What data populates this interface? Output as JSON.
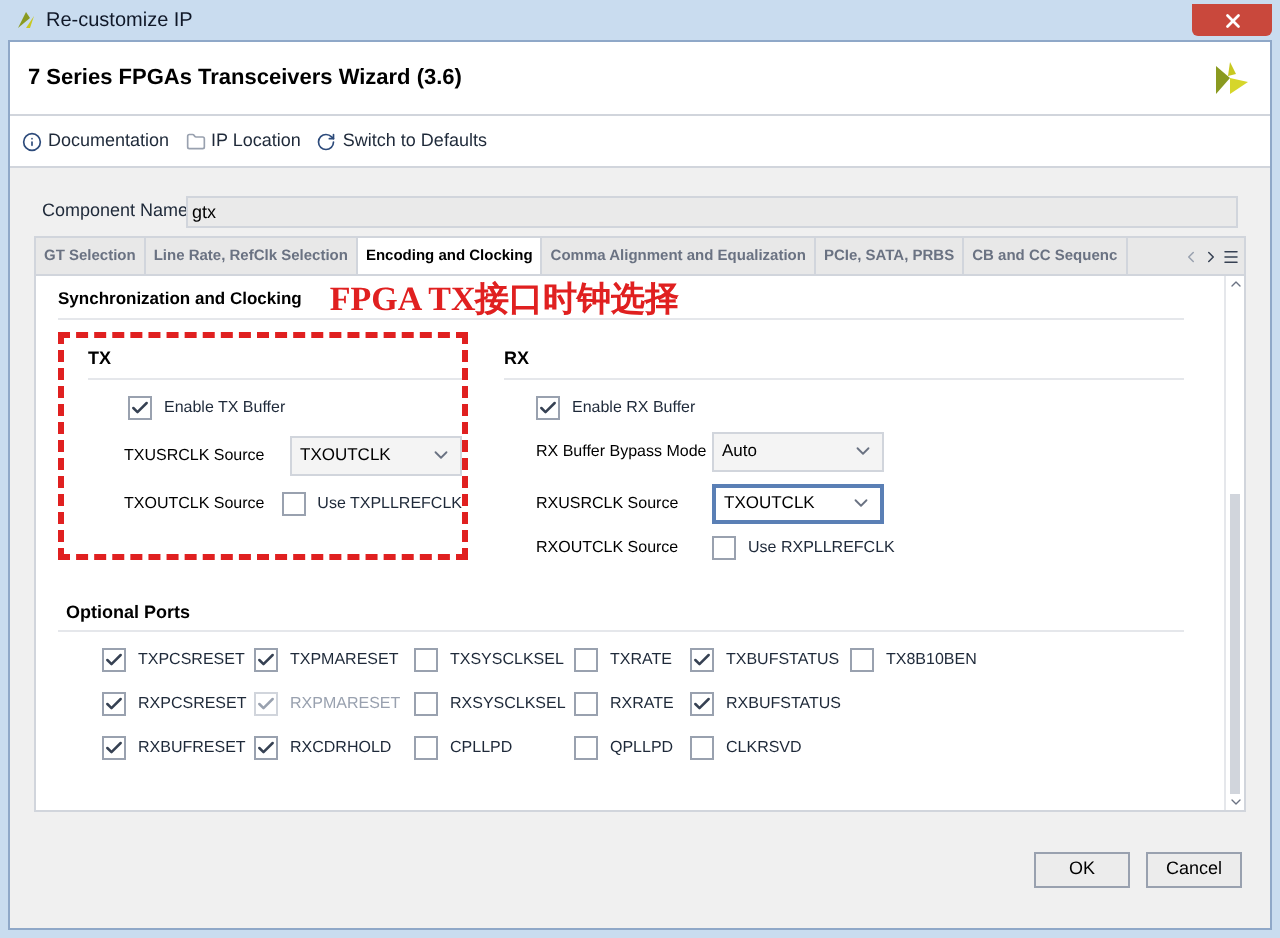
{
  "window": {
    "title": "Re-customize IP"
  },
  "header": {
    "title": "7 Series FPGAs Transceivers Wizard (3.6)"
  },
  "toolbar": [
    {
      "kind": "info",
      "label": "Documentation"
    },
    {
      "kind": "folder",
      "label": "IP Location"
    },
    {
      "kind": "reset",
      "label": "Switch to Defaults"
    }
  ],
  "component_name": {
    "label": "Component Name",
    "value": "gtx"
  },
  "tabs": [
    {
      "label": "GT Selection",
      "selected": false
    },
    {
      "label": "Line Rate, RefClk Selection",
      "selected": false
    },
    {
      "label": "Encoding and Clocking",
      "selected": true
    },
    {
      "label": "Comma Alignment and Equalization",
      "selected": false
    },
    {
      "label": "PCIe, SATA, PRBS",
      "selected": false
    },
    {
      "label": "CB and CC Sequenc",
      "selected": false
    }
  ],
  "section_title": "Synchronization and Clocking",
  "annotation": "FPGA TX接口时钟选择",
  "tx": {
    "title": "TX",
    "buffer": {
      "label": "Enable TX Buffer",
      "checked": true
    },
    "usrclk_label": "TXUSRCLK Source",
    "usrclk_value": "TXOUTCLK",
    "outclk_label": "TXOUTCLK Source",
    "outclk_option": {
      "label": "Use TXPLLREFCLK",
      "checked": false
    }
  },
  "rx": {
    "title": "RX",
    "buffer": {
      "label": "Enable RX Buffer",
      "checked": true
    },
    "bypass_label": "RX Buffer Bypass Mode",
    "bypass_value": "Auto",
    "usrclk_label": "RXUSRCLK Source",
    "usrclk_value": "TXOUTCLK",
    "outclk_label": "RXOUTCLK Source",
    "outclk_option": {
      "label": "Use RXPLLREFCLK",
      "checked": false
    }
  },
  "optional_ports": {
    "title": "Optional Ports",
    "rows": [
      [
        {
          "label": "TXPCSRESET",
          "checked": true,
          "disabled": false
        },
        {
          "label": "TXPMARESET",
          "checked": true,
          "disabled": false
        },
        {
          "label": "TXSYSCLKSEL",
          "checked": false,
          "disabled": false
        },
        {
          "label": "TXRATE",
          "checked": false,
          "disabled": false
        },
        {
          "label": "TXBUFSTATUS",
          "checked": true,
          "disabled": false
        },
        {
          "label": "TX8B10BEN",
          "checked": false,
          "disabled": false
        }
      ],
      [
        {
          "label": "RXPCSRESET",
          "checked": true,
          "disabled": false
        },
        {
          "label": "RXPMARESET",
          "checked": true,
          "disabled": true
        },
        {
          "label": "RXSYSCLKSEL",
          "checked": false,
          "disabled": false
        },
        {
          "label": "RXRATE",
          "checked": false,
          "disabled": false
        },
        {
          "label": "RXBUFSTATUS",
          "checked": true,
          "disabled": false
        }
      ],
      [
        {
          "label": "RXBUFRESET",
          "checked": true,
          "disabled": false
        },
        {
          "label": "RXCDRHOLD",
          "checked": true,
          "disabled": false
        },
        {
          "label": "CPLLPD",
          "checked": false,
          "disabled": false
        },
        {
          "label": "QPLLPD",
          "checked": false,
          "disabled": false
        },
        {
          "label": "CLKRSVD",
          "checked": false,
          "disabled": false
        }
      ]
    ]
  },
  "buttons": [
    "OK",
    "Cancel"
  ]
}
